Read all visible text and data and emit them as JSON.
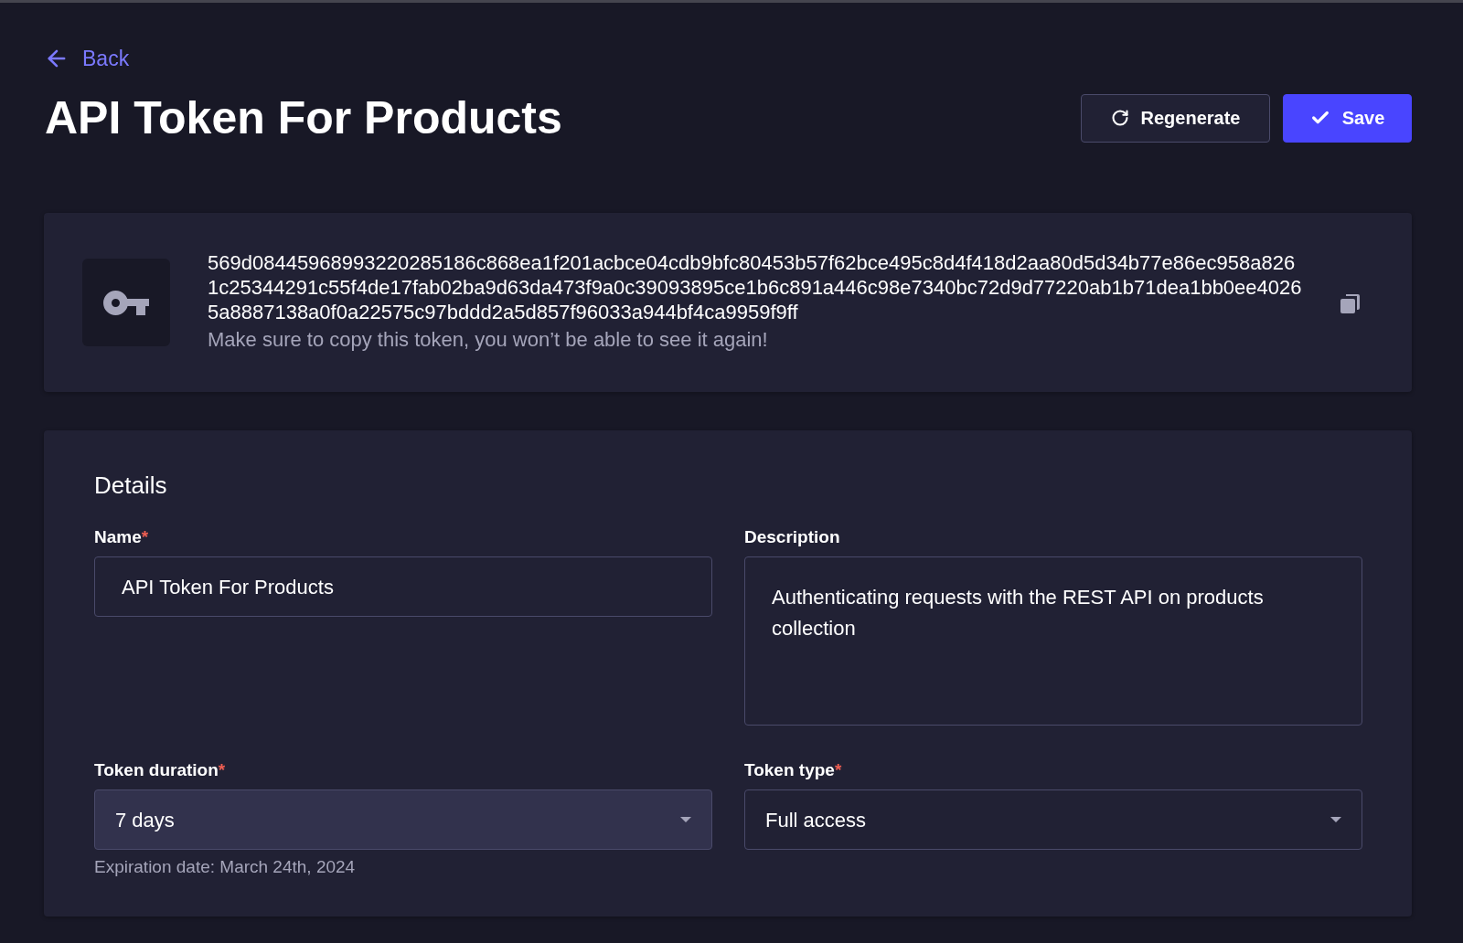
{
  "back_link": {
    "label": "Back"
  },
  "title": "API Token For Products",
  "actions": [
    {
      "kind": "regenerate",
      "label": "Regenerate"
    },
    {
      "kind": "save",
      "label": "Save"
    }
  ],
  "token_card": {
    "token": "569d08445968993220285186c868ea1f201acbce04cdb9bfc80453b57f62bce495c8d4f418d2aa80d5d34b77e86ec958a8261c25344291c55f4de17fab02ba9d63da473f9a0c39093895ce1b6c891a446c98e7340bc72d9d77220ab1b71dea1bb0ee40265a8887138a0f0a22575c97bddd2a5d857f96033a944bf4ca9959f9ff",
    "notice": "Make sure to copy this token, you won’t be able to see it again!"
  },
  "details": {
    "heading": "Details",
    "fields": [
      {
        "kind": "text",
        "label": "Name",
        "required_mark": "*",
        "value": "API Token For Products"
      },
      {
        "kind": "textarea",
        "label": "Description",
        "value": "Authenticating requests with the REST API on products collection"
      },
      {
        "kind": "select",
        "label": "Token duration",
        "required_mark": "*",
        "value": "7 days",
        "highlighted": true,
        "hint": "Expiration date: March 24th, 2024"
      },
      {
        "kind": "select",
        "label": "Token type",
        "required_mark": "*",
        "value": "Full access",
        "highlighted": false
      }
    ]
  }
}
